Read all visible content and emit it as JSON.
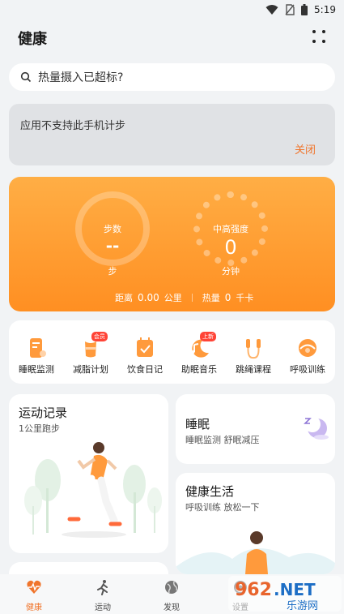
{
  "status_bar": {
    "time": "5:19",
    "icons": [
      "wifi-icon",
      "no-sim-icon",
      "battery-icon"
    ]
  },
  "header": {
    "title": "健康",
    "more_icon": "more-dots-icon"
  },
  "search": {
    "placeholder": "热量摄入已超标?",
    "icon": "search-icon"
  },
  "notice": {
    "text": "应用不支持此手机计步",
    "close_label": "关闭"
  },
  "steps_card": {
    "steps_label": "步数",
    "steps_value": "--",
    "steps_unit": "步",
    "intensity_label": "中高强度",
    "intensity_value": "0",
    "intensity_unit": "分钟",
    "distance_label": "距离",
    "distance_value": "0.00",
    "distance_unit": "公里",
    "calorie_label": "热量",
    "calorie_value": "0",
    "calorie_unit": "千卡",
    "gradient": [
      "#ffae45",
      "#ff8f22"
    ]
  },
  "shortcuts": [
    {
      "label": "睡眠监测",
      "icon": "sleep-monitor-icon"
    },
    {
      "label": "减脂计划",
      "icon": "fat-loss-plan-icon",
      "badge": "会员"
    },
    {
      "label": "饮食日记",
      "icon": "diet-diary-icon"
    },
    {
      "label": "助眠音乐",
      "icon": "sleep-music-icon",
      "badge": "上新"
    },
    {
      "label": "跳绳课程",
      "icon": "jump-rope-icon"
    },
    {
      "label": "呼吸训练",
      "icon": "breathing-icon"
    }
  ],
  "cards": {
    "exercise": {
      "title": "运动记录",
      "subtitle": "1公里跑步"
    },
    "sleep": {
      "title": "睡眠",
      "subtitle": "睡眠监测 舒眠减压"
    },
    "healthy_life": {
      "title": "健康生活",
      "subtitle": "呼吸训练 放松一下"
    }
  },
  "bottom_nav": [
    {
      "label": "健康",
      "icon": "heart-pulse-icon",
      "active": true
    },
    {
      "label": "运动",
      "icon": "running-icon",
      "active": false
    },
    {
      "label": "发现",
      "icon": "globe-icon",
      "active": false
    },
    {
      "label": "设置",
      "icon": "settings-icon",
      "active": false
    }
  ],
  "watermark": {
    "text": "962.NET",
    "subtext": "乐游网"
  },
  "colors": {
    "accent": "#f0752c",
    "background": "#f1f3f5",
    "card": "#ffffff"
  }
}
